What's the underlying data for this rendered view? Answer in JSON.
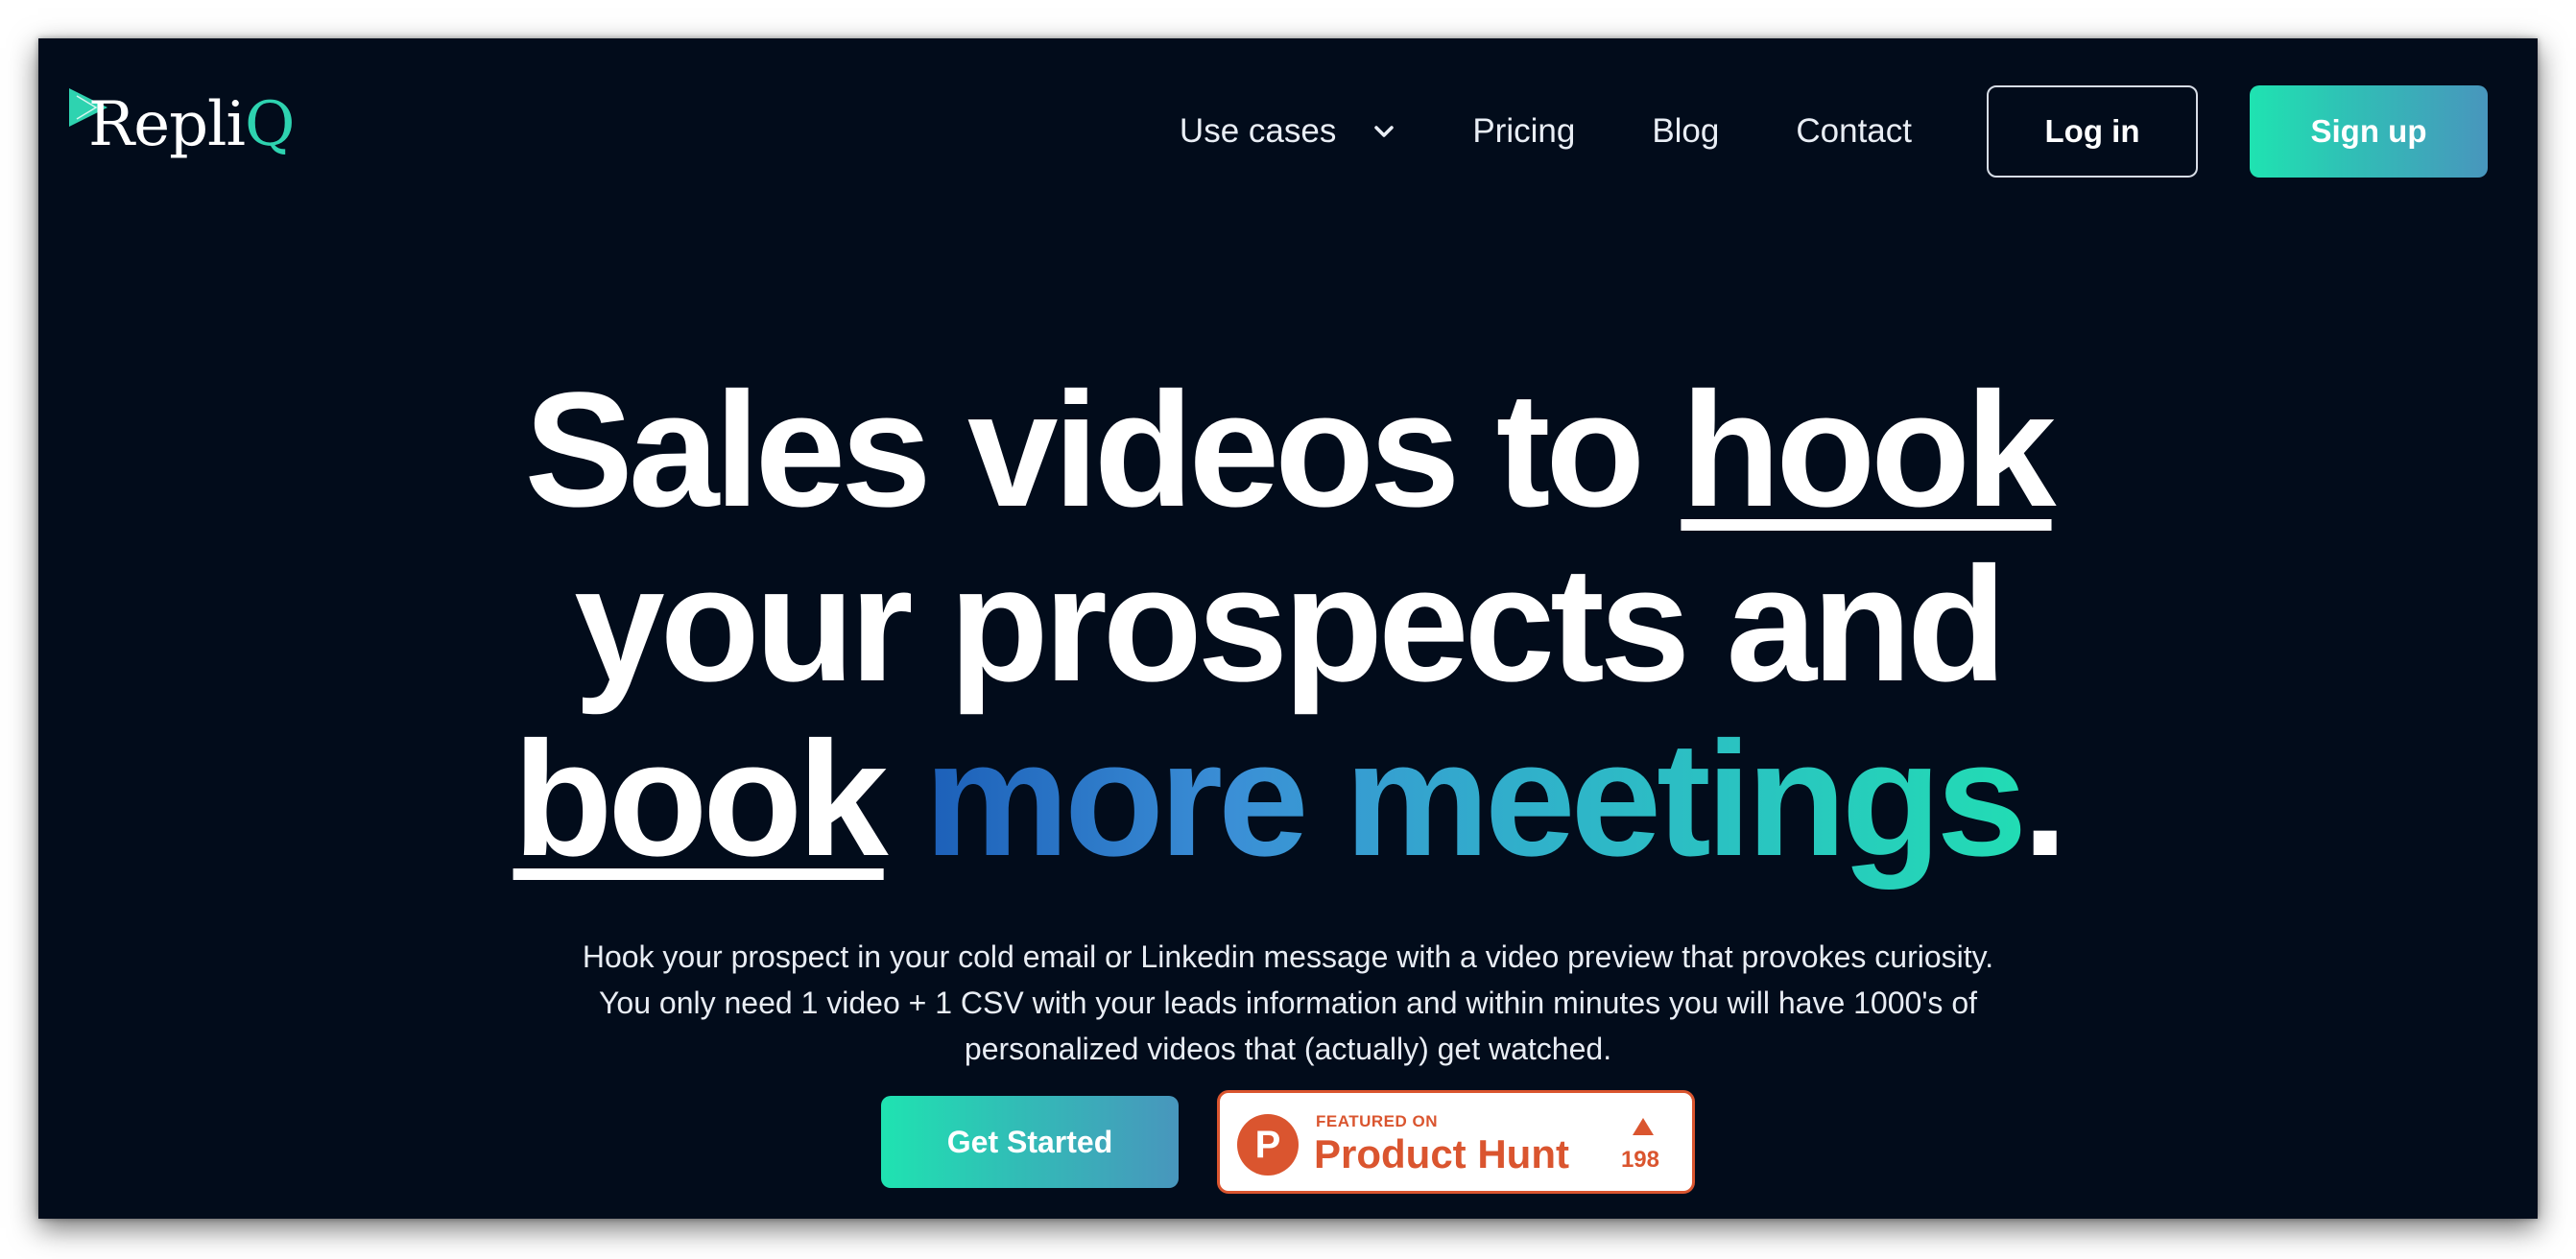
{
  "brand": {
    "name_main": "Repli",
    "name_accent": "Q",
    "logo_icon": "play-triangle-icon",
    "accent_color": "#2ed3b0"
  },
  "nav": {
    "items": [
      {
        "label": "Use cases",
        "icon": "chevron-down-icon"
      },
      {
        "label": "Pricing"
      },
      {
        "label": "Blog"
      },
      {
        "label": "Contact"
      }
    ],
    "login_label": "Log in",
    "signup_label": "Sign up"
  },
  "hero": {
    "title": {
      "part1": "Sales videos to ",
      "hook": "hook",
      "part2": "your prospects and",
      "book": "book",
      "gradient_text": "more meetings",
      "end": "."
    },
    "subtitle_lines": [
      "Hook your prospect in your cold email or Linkedin message with a video preview that provokes curiosity.",
      "You only need 1 video + 1 CSV with your leads information and within minutes you will have 1000's of",
      "personalized videos that (actually) get watched."
    ],
    "cta_label": "Get Started"
  },
  "product_hunt": {
    "featured_label": "FEATURED ON",
    "name": "Product Hunt",
    "logo_letter": "P",
    "upvotes": "198",
    "color": "#da552f"
  },
  "colors": {
    "background": "#020c1b",
    "button_gradient_start": "#1fe3b1",
    "button_gradient_end": "#4896bd",
    "title_gradient_start": "#1c5fb8",
    "title_gradient_end": "#22dcb4"
  }
}
